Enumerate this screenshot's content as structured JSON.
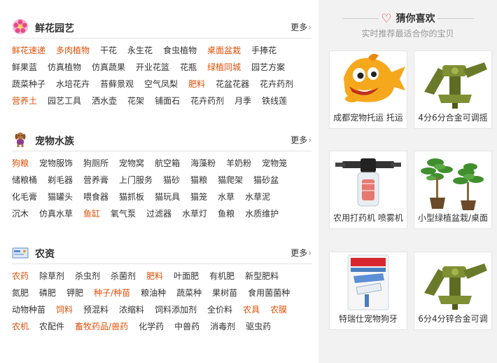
{
  "sections": [
    {
      "title": "鲜花园艺",
      "icon": "flower-icon",
      "more": "更多",
      "rows": [
        [
          {
            "t": "鲜花速递",
            "hot": true
          },
          {
            "t": "多肉植物",
            "hot": true
          },
          {
            "t": "干花"
          },
          {
            "t": "永生花"
          },
          {
            "t": "食虫植物"
          },
          {
            "t": "桌面盆栽",
            "hot": true
          },
          {
            "t": "手捧花"
          }
        ],
        [
          {
            "t": "鲜果蓝"
          },
          {
            "t": "仿真植物"
          },
          {
            "t": "仿真蔬果"
          },
          {
            "t": "开业花篮"
          },
          {
            "t": "花瓶"
          },
          {
            "t": "绿植同城",
            "hot": true
          },
          {
            "t": "园艺方案"
          }
        ],
        [
          {
            "t": "蔬菜种子"
          },
          {
            "t": "水培花卉"
          },
          {
            "t": "苔藓景观"
          },
          {
            "t": "空气凤梨"
          },
          {
            "t": "肥料",
            "hot": true
          },
          {
            "t": "花盆花器"
          },
          {
            "t": "花卉药剂"
          }
        ],
        [
          {
            "t": "营养土",
            "hot": true
          },
          {
            "t": "园艺工具"
          },
          {
            "t": "洒水壶"
          },
          {
            "t": "花架"
          },
          {
            "t": "铺面石"
          },
          {
            "t": "花卉药剂"
          },
          {
            "t": "月季"
          },
          {
            "t": "铁线莲"
          }
        ]
      ]
    },
    {
      "title": "宠物水族",
      "icon": "dog-icon",
      "more": "更多",
      "rows": [
        [
          {
            "t": "狗粮",
            "hot": true
          },
          {
            "t": "宠物服饰"
          },
          {
            "t": "狗厕所"
          },
          {
            "t": "宠物窝"
          },
          {
            "t": "航空箱"
          },
          {
            "t": "海藻粉"
          },
          {
            "t": "羊奶粉"
          },
          {
            "t": "宠物笼"
          }
        ],
        [
          {
            "t": "储粮桶"
          },
          {
            "t": "剃毛器"
          },
          {
            "t": "营养膏"
          },
          {
            "t": "上门服务"
          },
          {
            "t": "猫砂"
          },
          {
            "t": "猫粮"
          },
          {
            "t": "猫爬架"
          },
          {
            "t": "猫砂盆"
          }
        ],
        [
          {
            "t": "化毛膏"
          },
          {
            "t": "猫罐头"
          },
          {
            "t": "喂食器"
          },
          {
            "t": "猫抓板"
          },
          {
            "t": "猫玩具"
          },
          {
            "t": "猫笼"
          },
          {
            "t": "水草"
          },
          {
            "t": "水草泥"
          }
        ],
        [
          {
            "t": "沉木"
          },
          {
            "t": "仿真水草"
          },
          {
            "t": "鱼缸",
            "hot": true
          },
          {
            "t": "氧气泵"
          },
          {
            "t": "过滤器"
          },
          {
            "t": "水草灯"
          },
          {
            "t": "鱼粮"
          },
          {
            "t": "水质维护"
          }
        ]
      ]
    },
    {
      "title": "农资",
      "icon": "farm-supplies-icon",
      "more": "更多",
      "rows": [
        [
          {
            "t": "农药",
            "hot": true
          },
          {
            "t": "除草剂"
          },
          {
            "t": "杀虫剂"
          },
          {
            "t": "杀菌剂"
          },
          {
            "t": "肥料",
            "hot": true
          },
          {
            "t": "叶面肥"
          },
          {
            "t": "有机肥"
          },
          {
            "t": "新型肥料"
          }
        ],
        [
          {
            "t": "氮肥"
          },
          {
            "t": "磷肥"
          },
          {
            "t": "钾肥"
          },
          {
            "t": "种子/种苗",
            "hot": true
          },
          {
            "t": "粮油种"
          },
          {
            "t": "蔬菜种"
          },
          {
            "t": "果树苗"
          },
          {
            "t": "食用菌菌种"
          }
        ],
        [
          {
            "t": "动物种苗"
          },
          {
            "t": "饲料",
            "hot": true
          },
          {
            "t": "预混料"
          },
          {
            "t": "浓缩料"
          },
          {
            "t": "饲料添加剂"
          },
          {
            "t": "全价料"
          },
          {
            "t": "农具",
            "hot": true
          },
          {
            "t": "农膜",
            "hot": true
          }
        ],
        [
          {
            "t": "农机",
            "hot": true
          },
          {
            "t": "农配件"
          },
          {
            "t": "畜牧药品/兽药",
            "hot": true
          },
          {
            "t": "化学药"
          },
          {
            "t": "中兽药"
          },
          {
            "t": "消毒剂"
          },
          {
            "t": "驱虫药"
          }
        ]
      ]
    }
  ],
  "guess": {
    "title": "猜你喜欢",
    "subtitle": "实时推荐最适合你的宝贝",
    "items": [
      {
        "caption": "成都宠物托运 托运",
        "image": "mascot-image"
      },
      {
        "caption": "4分6分合金可调摇",
        "image": "sprinkler-image"
      },
      {
        "caption": "农用打药机 喷雾机",
        "image": "sprayer-part-image"
      },
      {
        "caption": "小型绿植盆栽/桌面",
        "image": "plant-image"
      },
      {
        "caption": "特瑞仕宠物狗牙",
        "image": "toothpaste-image"
      },
      {
        "caption": "6分4分锌合金可调",
        "image": "sprinkler-image"
      }
    ]
  },
  "colors": {
    "accent": "#e0500a",
    "heart": "#e0304a",
    "panel": "#f2f2f2"
  }
}
